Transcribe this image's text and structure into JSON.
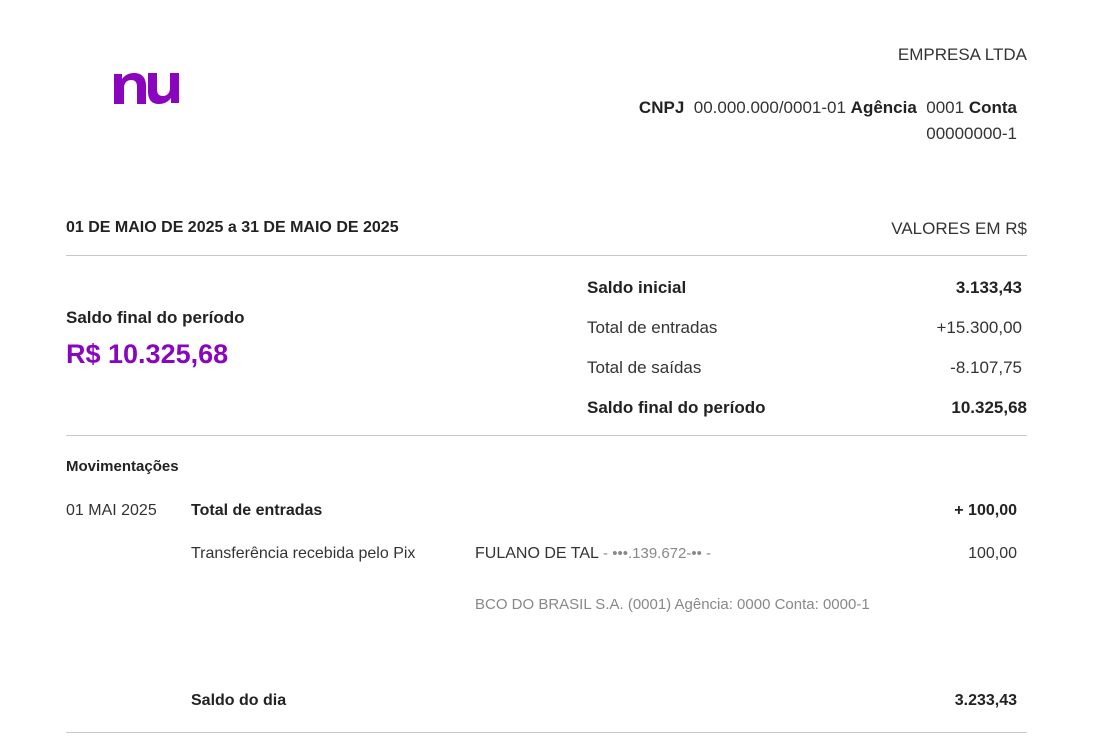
{
  "brand": {
    "color": "#8a05be",
    "logo_text": "nu"
  },
  "header": {
    "company": "EMPRESA LTDA",
    "cnpj_label": "CNPJ",
    "cnpj": "00.000.000/0001-01",
    "agencia_label": "Agência",
    "agencia": "0001",
    "conta_label": "Conta",
    "conta": "00000000-1"
  },
  "period": {
    "range": "01 DE MAIO DE 2025 a 31 DE MAIO DE 2025",
    "currency_note": "VALORES EM R$"
  },
  "summary": {
    "final_label": "Saldo final do período",
    "final_value": "R$ 10.325,68",
    "rows": [
      {
        "label": "Saldo inicial",
        "value": "3.133,43"
      },
      {
        "label": "Total de entradas",
        "value": "+15.300,00"
      },
      {
        "label": "Total de saídas",
        "value": "-8.107,75"
      },
      {
        "label": "Saldo final do período",
        "value": "10.325,68"
      }
    ]
  },
  "movements": {
    "title": "Movimentações",
    "days": [
      {
        "date": "01 MAI 2025",
        "group_label": "Total de entradas",
        "group_value": "+ 100,00",
        "transactions": [
          {
            "description": "Transferência recebida pelo Pix",
            "party": "FULANO DE TAL",
            "party_masked": " - •••.139.672-•• -",
            "bank": "BCO DO BRASIL S.A. (0001) Agência: 0000 Conta: 0000-1",
            "value": "100,00"
          }
        ],
        "day_balance_label": "Saldo do dia",
        "day_balance_value": "3.233,43"
      }
    ]
  }
}
